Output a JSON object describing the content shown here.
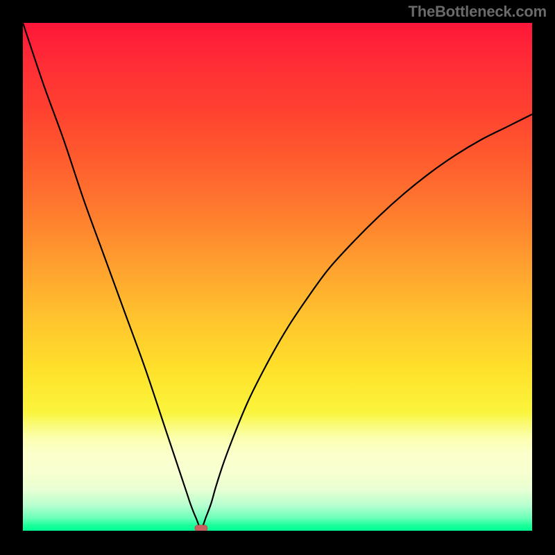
{
  "watermark": "TheBottleneck.com",
  "chart_data": {
    "type": "line",
    "title": "",
    "xlabel": "",
    "ylabel": "",
    "xlim": [
      0,
      100
    ],
    "ylim": [
      0,
      100
    ],
    "grid": false,
    "background": {
      "type": "vertical-gradient",
      "stops": [
        {
          "pos": 0,
          "color": "#ff1639"
        },
        {
          "pos": 8,
          "color": "#ff2d36"
        },
        {
          "pos": 18,
          "color": "#ff4330"
        },
        {
          "pos": 28,
          "color": "#ff5f2e"
        },
        {
          "pos": 38,
          "color": "#ff7e2e"
        },
        {
          "pos": 48,
          "color": "#ffa12f"
        },
        {
          "pos": 58,
          "color": "#ffc32e"
        },
        {
          "pos": 68,
          "color": "#ffe02a"
        },
        {
          "pos": 76,
          "color": "#fbf33a"
        },
        {
          "pos": 82,
          "color": "#f7ff6f"
        },
        {
          "pos": 88,
          "color": "#f0ffa8"
        },
        {
          "pos": 92,
          "color": "#e4ffd0"
        },
        {
          "pos": 95,
          "color": "#b8ffd0"
        },
        {
          "pos": 97.5,
          "color": "#6affb8"
        },
        {
          "pos": 99,
          "color": "#18ff9a"
        },
        {
          "pos": 100,
          "color": "#00ff92"
        }
      ]
    },
    "marker": {
      "x": 35,
      "y": 0.5,
      "color": "#c86060",
      "shape": "pill"
    },
    "series": [
      {
        "name": "bottleneck-curve",
        "color": "#000000",
        "x": [
          0,
          4,
          8,
          12,
          16,
          20,
          24,
          28,
          30,
          32,
          33,
          34,
          35,
          36,
          37,
          38,
          40,
          44,
          48,
          52,
          56,
          60,
          65,
          70,
          75,
          80,
          85,
          90,
          95,
          100
        ],
        "y": [
          100,
          88,
          77,
          65,
          54,
          43,
          32,
          20,
          14,
          8,
          5,
          2.5,
          0.5,
          2.8,
          5.5,
          9,
          15,
          25,
          33,
          40,
          46,
          51.5,
          57,
          62,
          66.5,
          70.5,
          74,
          77,
          79.5,
          82
        ]
      }
    ]
  }
}
